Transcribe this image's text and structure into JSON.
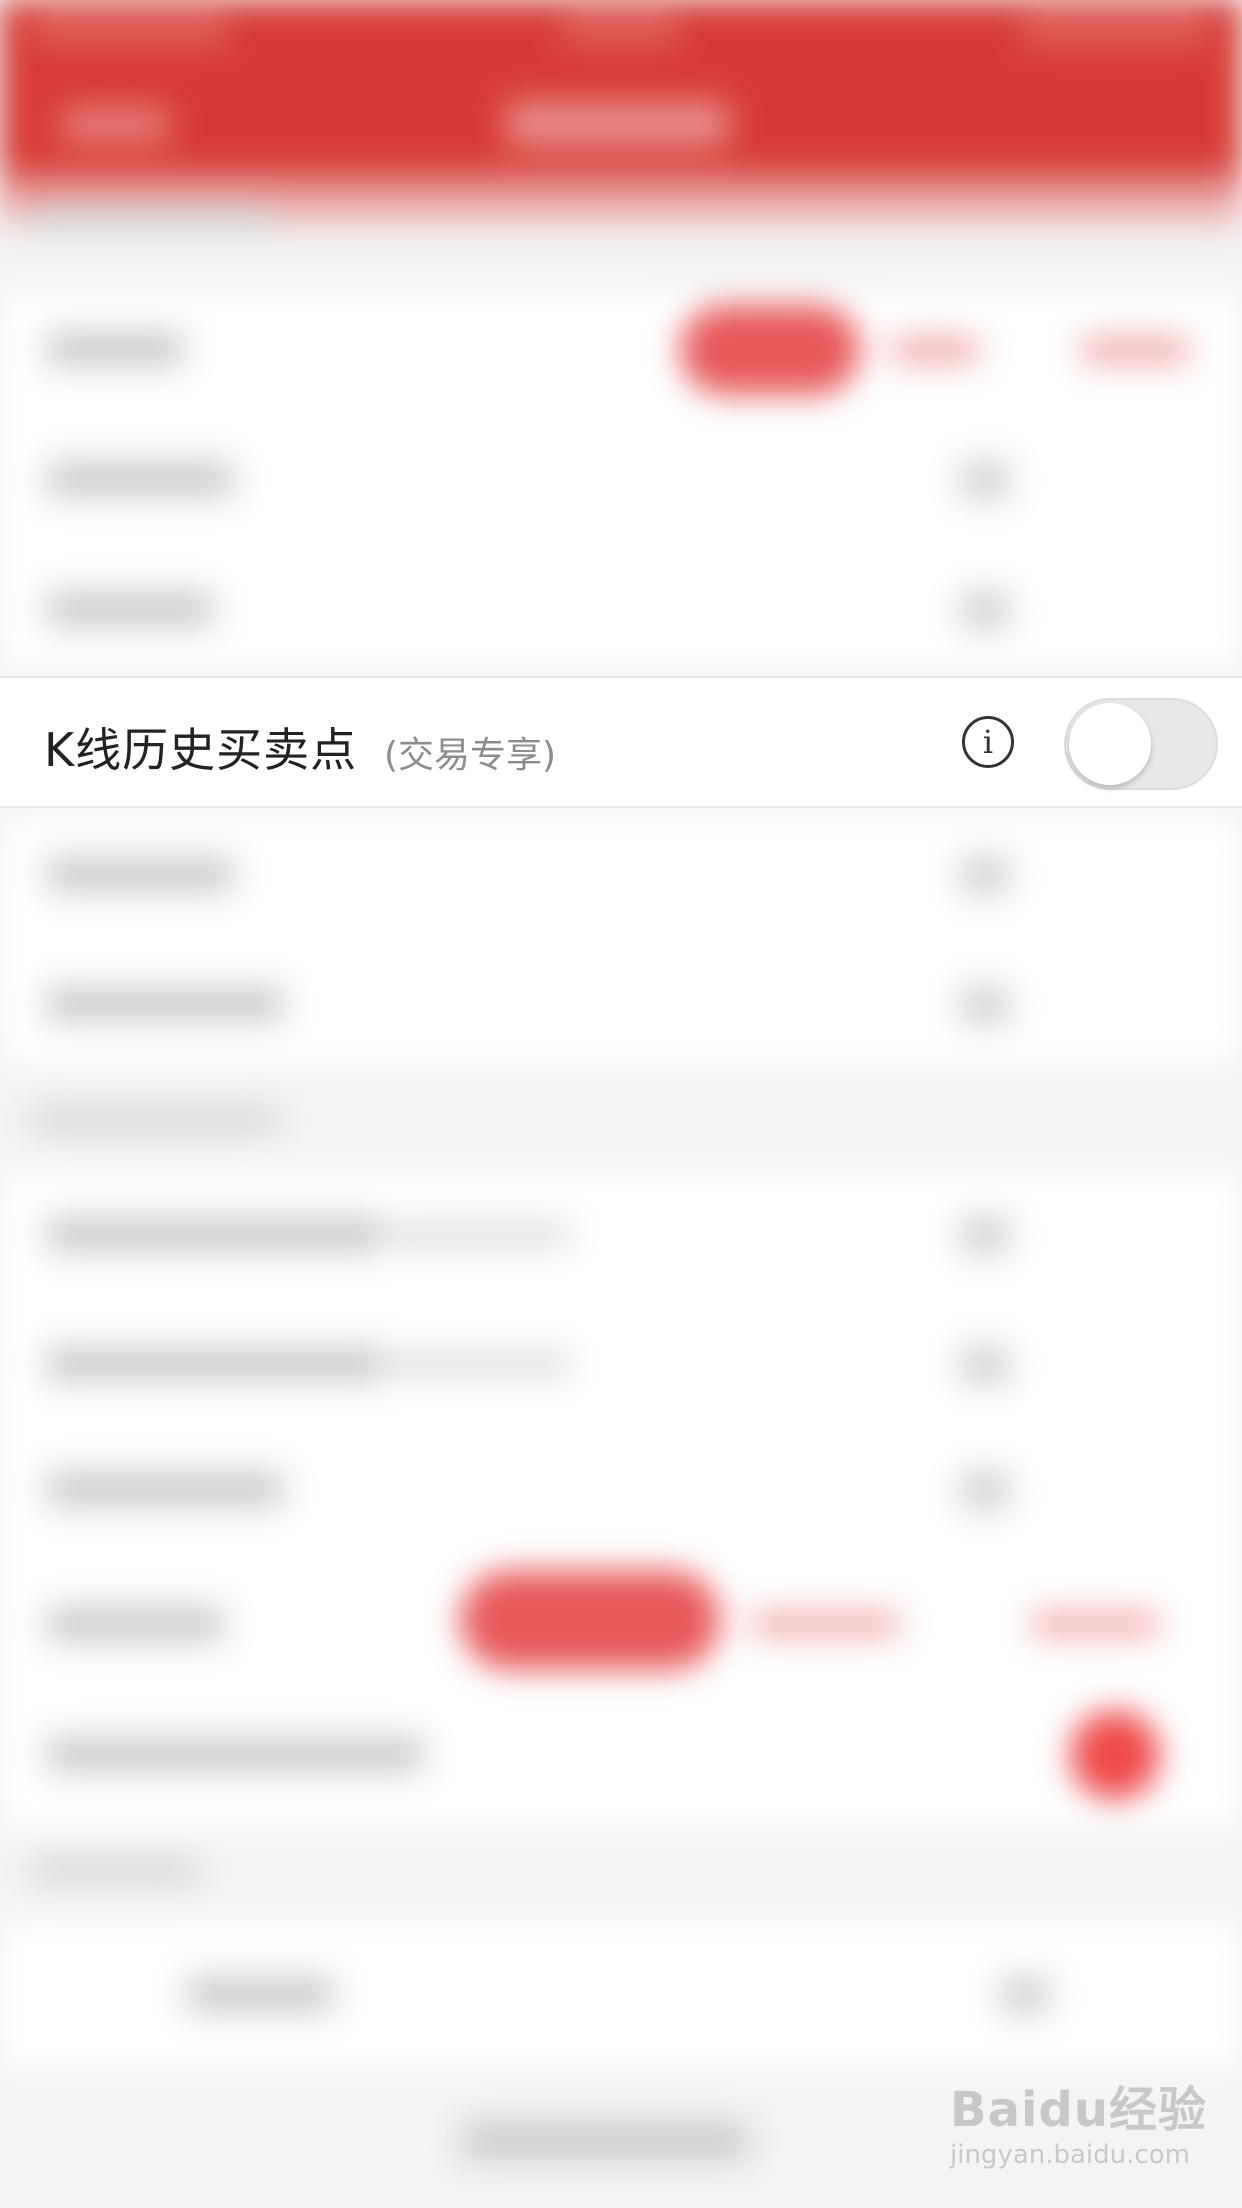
{
  "kline_row": {
    "title": "K线历史买卖点",
    "subtitle": "(交易专享)",
    "info_icon": "info-icon",
    "toggle_on": false
  },
  "watermark": {
    "brand": "Baidu经验",
    "url": "jingyan.baidu.com"
  },
  "colors": {
    "header_red": "#d63a34",
    "accent_red": "#e85a5a",
    "toggle_off": "#e7e7e7"
  }
}
